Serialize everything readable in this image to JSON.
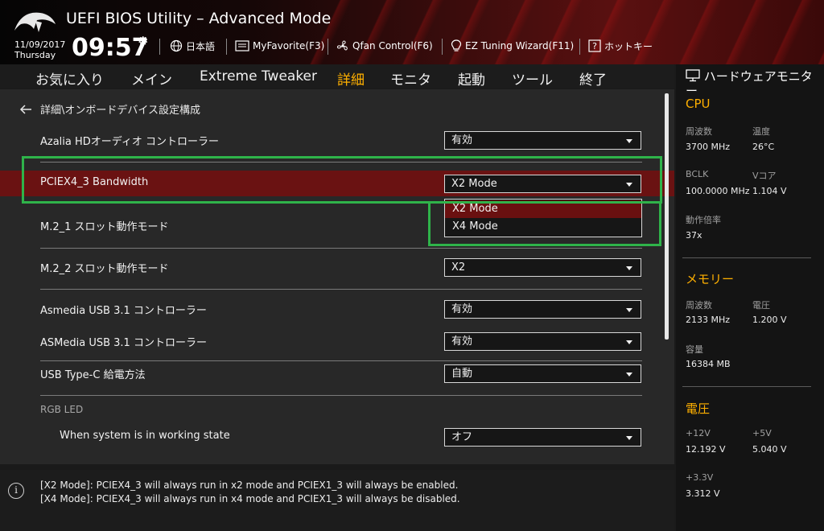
{
  "header": {
    "title": "UEFI BIOS Utility – Advanced Mode",
    "date": "11/09/2017",
    "day": "Thursday",
    "time": "09:57",
    "toolbar": [
      {
        "label": "日本語",
        "icon": "globe-icon"
      },
      {
        "label": "MyFavorite(F3)",
        "icon": "favorite-list-icon"
      },
      {
        "label": "Qfan Control(F6)",
        "icon": "fan-icon"
      },
      {
        "label": "EZ Tuning Wizard(F11)",
        "icon": "lightbulb-icon"
      },
      {
        "label": "ホットキー",
        "icon": "hotkey-icon"
      }
    ]
  },
  "menu": {
    "tabs": [
      "お気に入り",
      "メイン",
      "Extreme Tweaker",
      "詳細",
      "モニタ",
      "起動",
      "ツール",
      "終了"
    ],
    "active": "詳細"
  },
  "breadcrumb": "詳細\\オンボードデバイス設定構成",
  "settings": [
    {
      "label": "Azalia HDオーディオ コントローラー",
      "value": "有効"
    },
    {
      "label": "PCIEX4_3 Bandwidth",
      "value": "X2 Mode"
    },
    {
      "label": "M.2_1 スロット動作モード",
      "value": ""
    },
    {
      "label": "M.2_2 スロット動作モード",
      "value": "X2"
    },
    {
      "label": "Asmedia USB 3.1 コントローラー",
      "value": "有効"
    },
    {
      "label": "ASMedia USB 3.1 コントローラー",
      "value": "有効"
    },
    {
      "label": "USB Type-C 給電方法",
      "value": "自動"
    },
    {
      "label": "When system is in working state",
      "value": "オフ"
    }
  ],
  "section_rgb": "RGB LED",
  "dropdown_options": [
    "X2 Mode",
    "X4 Mode"
  ],
  "dropdown_selected": "X2 Mode",
  "help": [
    "[X2 Mode]: PCIEX4_3 will always run in x2 mode and PCIEX1_3 will always be enabled.",
    "[X4 Mode]: PCIEX4_3 will always run in x4 mode and PCIEX1_3 will always be disabled."
  ],
  "monitor": {
    "title": "ハードウェアモニター",
    "cpu": {
      "heading": "CPU",
      "freq_label": "周波数",
      "freq": "3700 MHz",
      "temp_label": "温度",
      "temp": "26°C",
      "bclk_label": "BCLK",
      "bclk": "100.0000 MHz",
      "vcore_label": "Vコア",
      "vcore": "1.104 V",
      "ratio_label": "動作倍率",
      "ratio": "37x"
    },
    "memory": {
      "heading": "メモリー",
      "freq_label": "周波数",
      "freq": "2133 MHz",
      "volt_label": "電圧",
      "volt": "1.200 V",
      "cap_label": "容量",
      "cap": "16384 MB"
    },
    "voltage": {
      "heading": "電圧",
      "v12_label": "+12V",
      "v12": "12.192 V",
      "v5_label": "+5V",
      "v5": "5.040 V",
      "v33_label": "+3.3V",
      "v33": "3.312 V"
    }
  },
  "colors": {
    "accent": "#ffb000",
    "highlight": "#6a1212",
    "annotation": "#2fb34a"
  }
}
